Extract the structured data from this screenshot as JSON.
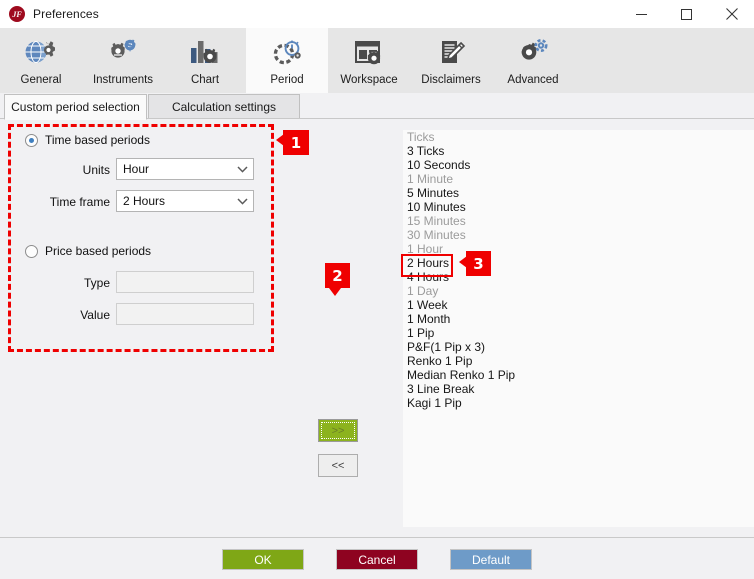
{
  "window": {
    "title": "Preferences",
    "app_icon": "jforex-logo-icon",
    "controls": {
      "minimize": "minimize-icon",
      "maximize": "maximize-icon",
      "close": "close-icon"
    }
  },
  "toolbar": {
    "items": [
      {
        "label": "General",
        "icon": "globe-gear-icon",
        "selected": false
      },
      {
        "label": "Instruments",
        "icon": "gear-dollar-icon",
        "selected": false
      },
      {
        "label": "Chart",
        "icon": "bar-chart-gear-icon",
        "selected": false
      },
      {
        "label": "Period",
        "icon": "gear-stopwatch-icon",
        "selected": true
      },
      {
        "label": "Workspace",
        "icon": "window-gear-icon",
        "selected": false
      },
      {
        "label": "Disclaimers",
        "icon": "document-pen-icon",
        "selected": false
      },
      {
        "label": "Advanced",
        "icon": "double-gear-icon",
        "selected": false
      }
    ]
  },
  "tabs": [
    {
      "label": "Custom period selection",
      "active": true
    },
    {
      "label": "Calculation settings",
      "active": false
    }
  ],
  "left_panel": {
    "time_based": {
      "radio_label": "Time based periods",
      "selected": true,
      "units_label": "Units",
      "units_value": "Hour",
      "timeframe_label": "Time frame",
      "timeframe_value": "2 Hours"
    },
    "price_based": {
      "radio_label": "Price based periods",
      "selected": false,
      "type_label": "Type",
      "type_value": "",
      "value_label": "Value",
      "value_value": ""
    }
  },
  "transfer": {
    "add_label": ">>",
    "remove_label": "<<"
  },
  "list": {
    "items": [
      {
        "label": "Ticks",
        "enabled": false
      },
      {
        "label": "3 Ticks",
        "enabled": true
      },
      {
        "label": "10 Seconds",
        "enabled": true
      },
      {
        "label": "1 Minute",
        "enabled": false
      },
      {
        "label": "5 Minutes",
        "enabled": true
      },
      {
        "label": "10 Minutes",
        "enabled": true
      },
      {
        "label": "15 Minutes",
        "enabled": false
      },
      {
        "label": "30 Minutes",
        "enabled": false
      },
      {
        "label": "1 Hour",
        "enabled": false
      },
      {
        "label": "2 Hours",
        "enabled": true
      },
      {
        "label": "4 Hours",
        "enabled": true
      },
      {
        "label": "1 Day",
        "enabled": false
      },
      {
        "label": "1 Week",
        "enabled": true
      },
      {
        "label": "1 Month",
        "enabled": true
      },
      {
        "label": "1 Pip",
        "enabled": true
      },
      {
        "label": "P&F(1 Pip x 3)",
        "enabled": true
      },
      {
        "label": "Renko 1 Pip",
        "enabled": true
      },
      {
        "label": "Median Renko 1 Pip",
        "enabled": true
      },
      {
        "label": "3 Line Break",
        "enabled": true
      },
      {
        "label": "Kagi 1 Pip",
        "enabled": true
      }
    ]
  },
  "annotations": {
    "badge_1": "1",
    "badge_2": "2",
    "badge_3": "3",
    "color": "#ef0000"
  },
  "footer": {
    "ok_label": "OK",
    "cancel_label": "Cancel",
    "default_label": "Default",
    "ok_color": "#7fa716",
    "cancel_color": "#8e0320",
    "default_color": "#6e9bc8"
  }
}
